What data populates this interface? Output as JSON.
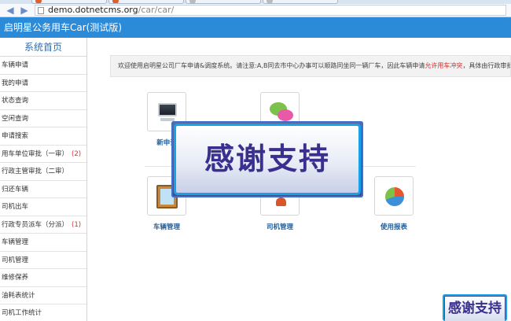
{
  "browser": {
    "tabs": [
      "",
      "",
      "",
      ""
    ],
    "url_host": "demo.dotnetcms.org",
    "url_path": "/car/car/"
  },
  "app": {
    "title": "启明星公务用车Car(测试版)"
  },
  "sidebar": {
    "home": "系统首页",
    "items": [
      {
        "label": "车辆申请"
      },
      {
        "label": "我的申请"
      },
      {
        "label": "状态查询"
      },
      {
        "label": "空闲查询"
      },
      {
        "label": "申请搜索"
      },
      {
        "label": "用车单位审批（一审）",
        "count": "(2)"
      },
      {
        "label": "行政主管审批（二审）"
      },
      {
        "label": "归还车辆"
      },
      {
        "label": "司机出车"
      },
      {
        "label": "行政专员派车（分派）",
        "count": "(1)"
      },
      {
        "label": "车辆管理"
      },
      {
        "label": "司机管理"
      },
      {
        "label": "维修保养"
      },
      {
        "label": "油耗表统计"
      },
      {
        "label": "司机工作统计"
      }
    ]
  },
  "main": {
    "notice_before": "欢迎使用启明星公司厂车申请&调度系统。请注意:A,B同去市中心办事可以顺路同坐同一辆厂车，因此车辆申请",
    "notice_highlight": "允许用车冲突",
    "notice_after": "，具体由行政审批人员调度",
    "tiles": [
      {
        "label": "新申请",
        "icon": "monitor-icon"
      },
      {
        "label": "",
        "icon": "chat-icon"
      },
      {
        "label": "车辆管理",
        "icon": "picture-frame-icon"
      },
      {
        "label": "司机管理",
        "icon": "driver-icon"
      },
      {
        "label": "使用报表",
        "icon": "pie-chart-icon"
      }
    ]
  },
  "watermark": {
    "text": "感谢支持",
    "small_text": "感谢支持"
  },
  "colors": {
    "header": "#2c8bd8",
    "highlight": "#e02b2b",
    "tile_label": "#1f5d9c"
  }
}
